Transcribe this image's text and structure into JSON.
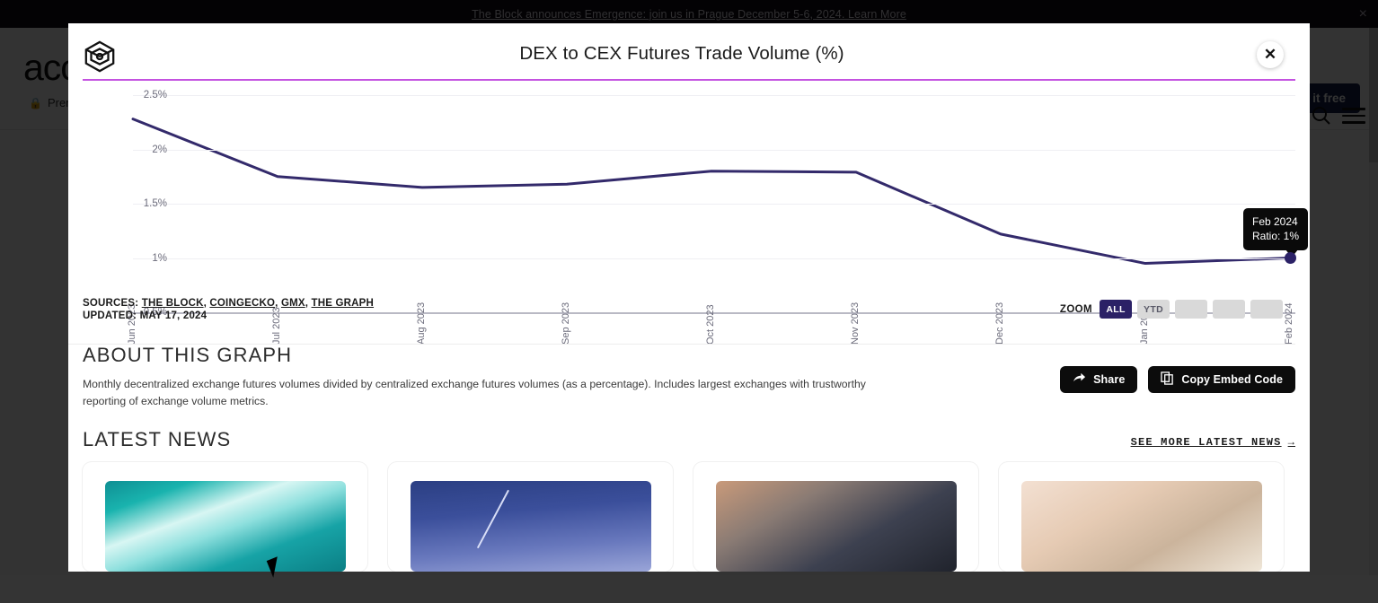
{
  "banner": {
    "text": "The Block announces Emergence: join us in Prague December 5-6, 2024. Learn More",
    "close_label": "×"
  },
  "site_header": {
    "brand": "acc",
    "premium_label": "Prem",
    "lock_icon": "🔒",
    "try_free_label": "Try it free",
    "search_icon": "search-icon",
    "menu_icon": "hamburger-menu-icon"
  },
  "modal": {
    "close_label": "✕",
    "logo_name": "the-block-cube-logo"
  },
  "chart_data": {
    "type": "line",
    "title": "DEX to CEX Futures Trade Volume (%)",
    "xlabel": "",
    "ylabel": "",
    "categories": [
      "Jun 2023",
      "Jul 2023",
      "Aug 2023",
      "Sep 2023",
      "Oct 2023",
      "Nov 2023",
      "Dec 2023",
      "Jan 2024",
      "Feb 2024"
    ],
    "series": [
      {
        "name": "Ratio",
        "values": [
          2.28,
          1.75,
          1.65,
          1.68,
          1.8,
          1.79,
          1.22,
          0.95,
          1.0
        ]
      }
    ],
    "ytick_labels": [
      "2.5%",
      "2%",
      "1.5%",
      "1%",
      "0.5%"
    ],
    "ytick_values": [
      2.5,
      2.0,
      1.5,
      1.0,
      0.5
    ],
    "ylim": [
      0.5,
      2.5
    ],
    "grid": true,
    "legend": "none",
    "line_color": "#332a6b",
    "accent_color": "#c452e0",
    "point_color": "#2b2166",
    "highlight_point": {
      "category": "Feb 2024",
      "value": 1.0,
      "tooltip_title": "Feb 2024",
      "tooltip_value": "Ratio: 1%"
    }
  },
  "meta": {
    "sources_label": "SOURCES:",
    "sources": [
      "THE BLOCK",
      "COINGECKO",
      "GMX",
      "THE GRAPH"
    ],
    "updated_label": "UPDATED:",
    "updated_value": "MAY 17, 2024"
  },
  "zoom_control": {
    "label": "ZOOM",
    "buttons": [
      {
        "label": "ALL",
        "active": true
      },
      {
        "label": "YTD",
        "active": false
      },
      {
        "label": "",
        "active": false
      },
      {
        "label": "",
        "active": false
      },
      {
        "label": "",
        "active": false
      }
    ]
  },
  "about": {
    "heading": "ABOUT THIS GRAPH",
    "body": "Monthly decentralized exchange futures volumes divided by centralized exchange futures volumes (as a percentage). Includes largest exchanges with trustworthy reporting of exchange volume metrics.",
    "share_label": "Share",
    "share_icon": "share-arrow-icon",
    "embed_label": "Copy Embed Code",
    "embed_icon": "copy-icon"
  },
  "news": {
    "heading": "LATEST NEWS",
    "see_more_label": "SEE MORE LATEST NEWS",
    "see_more_arrow": "→",
    "cards": [
      {
        "thumb": "iceberg-aerial-photo"
      },
      {
        "thumb": "night-sky-comet-photo"
      },
      {
        "thumb": "credit-cards-photo"
      },
      {
        "thumb": "cash-money-photo"
      }
    ]
  }
}
